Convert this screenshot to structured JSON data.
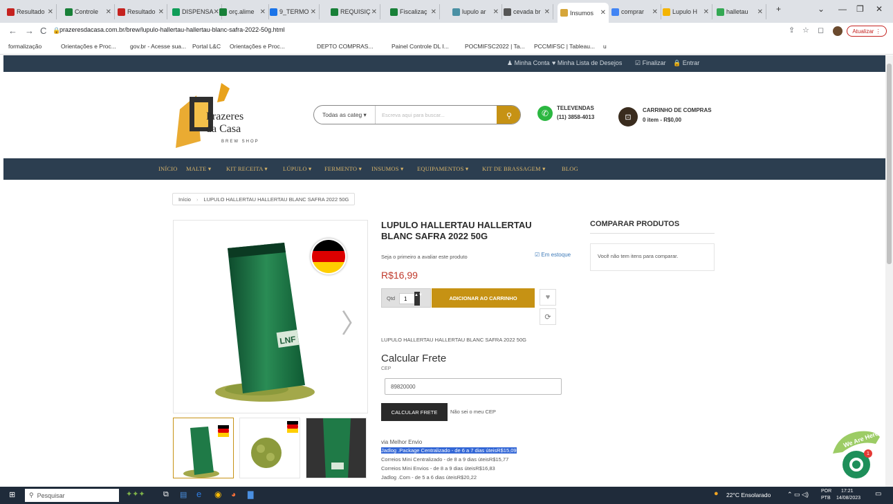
{
  "browser": {
    "tabs": [
      {
        "label": "Resultado",
        "color": "#c5221f"
      },
      {
        "label": "Controle",
        "color": "#188038"
      },
      {
        "label": "Resultado",
        "color": "#c5221f"
      },
      {
        "label": "DISPENSA",
        "color": "#0f9d58"
      },
      {
        "label": "orç.alime",
        "color": "#188038"
      },
      {
        "label": "9_TERMO",
        "color": "#1a73e8"
      },
      {
        "label": "REQUISIÇ",
        "color": "#188038"
      },
      {
        "label": "Fiscalizaç",
        "color": "#188038"
      },
      {
        "label": "lupulo ar",
        "color": "#4a90a4"
      },
      {
        "label": "cevada br",
        "color": "#555555"
      },
      {
        "label": "Insumos",
        "color": "#d6a63a"
      },
      {
        "label": "comprar",
        "color": "#4285f4"
      },
      {
        "label": "Lupulo H",
        "color": "#f4b400"
      },
      {
        "label": "halletau",
        "color": "#34a853"
      }
    ],
    "new_tab": "+",
    "url": "prazeresdacasa.com.br/brew/lupulo-hallertau-hallertau-blanc-safra-2022-50g.html",
    "update_button": "Atualizar",
    "bookmarks": [
      "formalização",
      "Orientações e Proc...",
      "gov.br - Acesse sua...",
      "Portal L&C",
      "Orientações e Proc...",
      "DEPTO COMPRAS...",
      "Painel Controle DL I...",
      "POCMIFSC2022 | Ta...",
      "PCCMIFSC | Tableau...",
      "u"
    ]
  },
  "site": {
    "topbar": {
      "account": "Minha Conta",
      "wishlist": "Minha Lista de Desejos",
      "checkout": "Finalizar",
      "login": "Entrar"
    },
    "logo": {
      "line1": "Prazeres",
      "line2": "da Casa",
      "line3": "BREW SHOP"
    },
    "search": {
      "category": "Todas as categ",
      "placeholder": "Escreva aqui para buscar..."
    },
    "phone": {
      "label": "TELEVENDAS",
      "number": "(11) 3858-4013"
    },
    "cart": {
      "label": "CARRINHO DE COMPRAS",
      "summary": "0 item - R$0,00"
    },
    "nav": [
      "INÍCIO",
      "MALTE ▾",
      "KIT RECEITA ▾",
      "LÚPULO ▾",
      "FERMENTO ▾",
      "INSUMOS ▾",
      "EQUIPAMENTOS ▾",
      "KIT DE BRASSAGEM ▾",
      "BLOG"
    ],
    "breadcrumb": {
      "home": "Início",
      "current": "LUPULO HALLERTAU HALLERTAU BLANC SAFRA 2022 50G"
    },
    "product": {
      "title_line1": "LUPULO HALLERTAU HALLERTAU",
      "title_line2": "BLANC SAFRA 2022 50G",
      "review": "Seja o primeiro a avaliar este produto",
      "stock": "Em estoque",
      "price": "R$16,99",
      "qty_label": "Qtd",
      "qty": "1",
      "add_to_cart": "ADICIONAR AO CARRINHO",
      "sku_text": "LUPULO HALLERTAU HALLERTAU BLANC SAFRA 2022 50G",
      "package_brand": "LNF"
    },
    "shipping": {
      "title": "Calcular Frete",
      "cep_label": "CEP",
      "cep_value": "89820000",
      "button": "CALCULAR FRETE",
      "unknown_cep": "Não sei o meu CEP",
      "provider": "via Melhor Envio",
      "options": [
        "Jadlog .Package Centralizado - de 6 a 7 dias úteisR$15,09",
        "Correios Mini Centralizado - de 8 a 9 dias úteisR$15,77",
        "Correios Mini Envios - de 8 a 9 dias úteisR$16,83",
        "Jadlog .Com - de 5 a 6 dias úteisR$20,22"
      ]
    },
    "compare": {
      "title": "COMPARAR PRODUTOS",
      "empty": "Você não tem itens para comparar."
    },
    "chat_badge": "1",
    "chat_text": "We Are Here!"
  },
  "taskbar": {
    "search": "Pesquisar",
    "weather": "22°C Ensolarado",
    "lang1": "POR",
    "lang2": "PTB",
    "time": "17:21",
    "date": "14/08/2023"
  }
}
